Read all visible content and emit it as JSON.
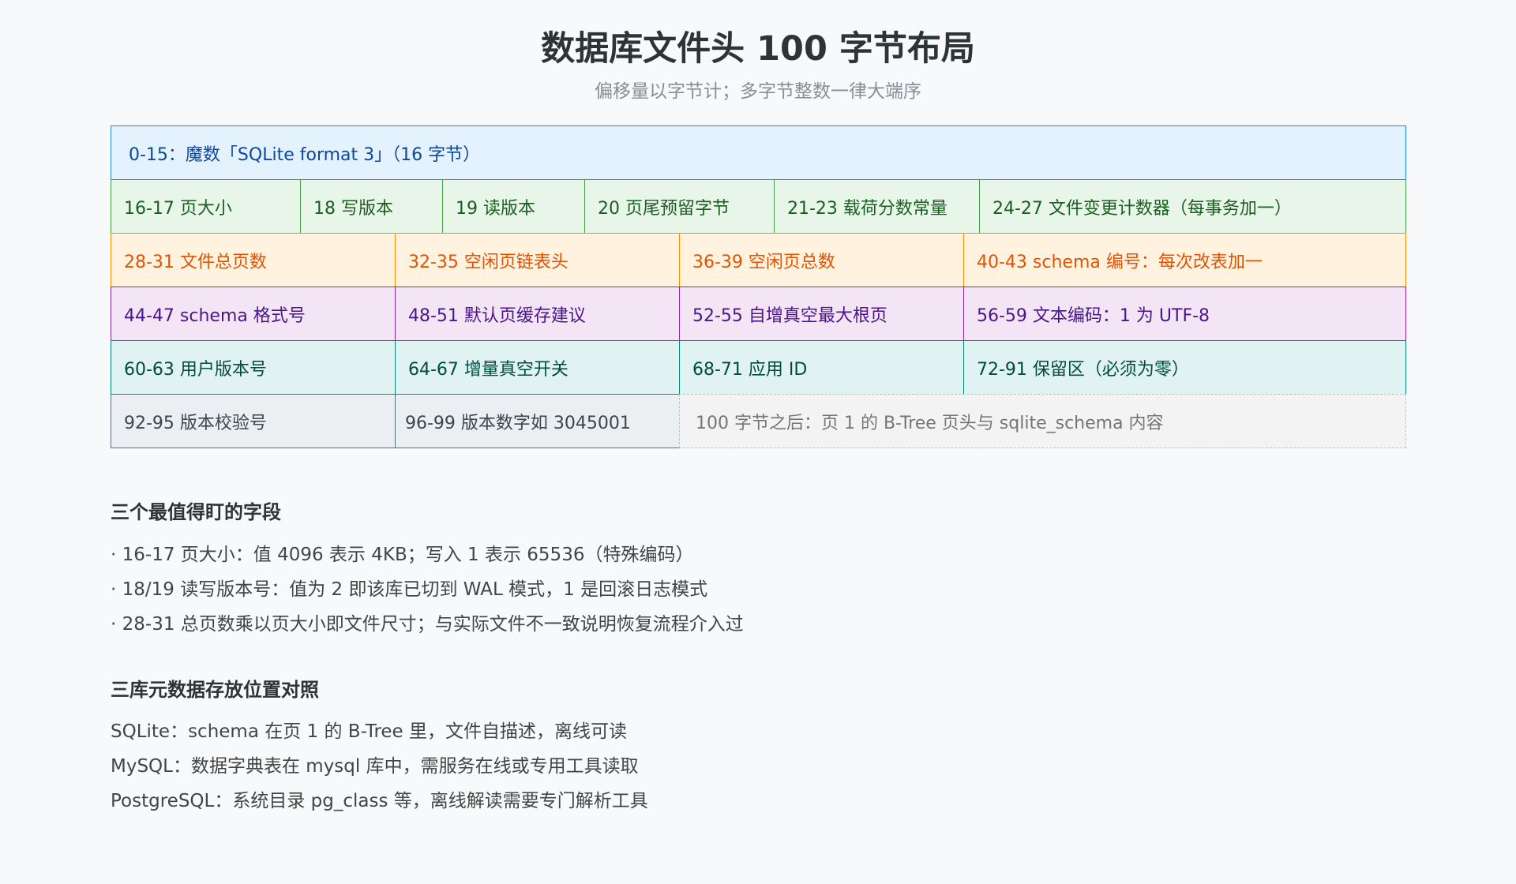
{
  "header": {
    "title": "数据库文件头 100 字节布局",
    "subtitle": "偏移量以字节计；多字节整数一律大端序"
  },
  "layout": {
    "row1": [
      "0-15：魔数「SQLite format 3」（16 字节）"
    ],
    "row2": [
      "16-17 页大小",
      "18 写版本",
      "19 读版本",
      "20 页尾预留字节",
      "21-23 载荷分数常量",
      "24-27 文件变更计数器（每事务加一）"
    ],
    "row3": [
      "28-31 文件总页数",
      "32-35 空闲页链表头",
      "36-39 空闲页总数",
      "40-43 schema 编号：每次改表加一"
    ],
    "row4": [
      "44-47 schema 格式号",
      "48-51 默认页缓存建议",
      "52-55 自增真空最大根页",
      "56-59 文本编码：1 为 UTF-8"
    ],
    "row5": [
      "60-63 用户版本号",
      "64-67 增量真空开关",
      "68-71 应用 ID",
      "72-91 保留区（必须为零）"
    ],
    "row6": [
      "92-95 版本校验号",
      "96-99 版本数字如 3045001",
      "100 字节之后：页 1 的 B-Tree 页头与 sqlite_schema 内容"
    ]
  },
  "fields": {
    "heading": "三个最值得盯的字段",
    "items": [
      "· 16-17 页大小：值 4096 表示 4KB；写入 1 表示 65536（特殊编码）",
      "· 18/19 读写版本号：值为 2 即该库已切到 WAL 模式，1 是回滚日志模式",
      "· 28-31 总页数乘以页大小即文件尺寸；与实际文件不一致说明恢复流程介入过"
    ]
  },
  "comparison": {
    "heading": "三库元数据存放位置对照",
    "items": [
      "SQLite：schema 在页 1 的 B-Tree 里，文件自描述，离线可读",
      "MySQL：数据字典表在 mysql 库中，需服务在线或专用工具读取",
      "PostgreSQL：系统目录 pg_class 等，离线解读需要专门解析工具"
    ]
  },
  "colors": {
    "blue": "#1e88e5",
    "green": "#43a047",
    "orange": "#fb8c00",
    "purple": "#8e24aa",
    "teal": "#00897b",
    "gray": "#546e7a"
  }
}
